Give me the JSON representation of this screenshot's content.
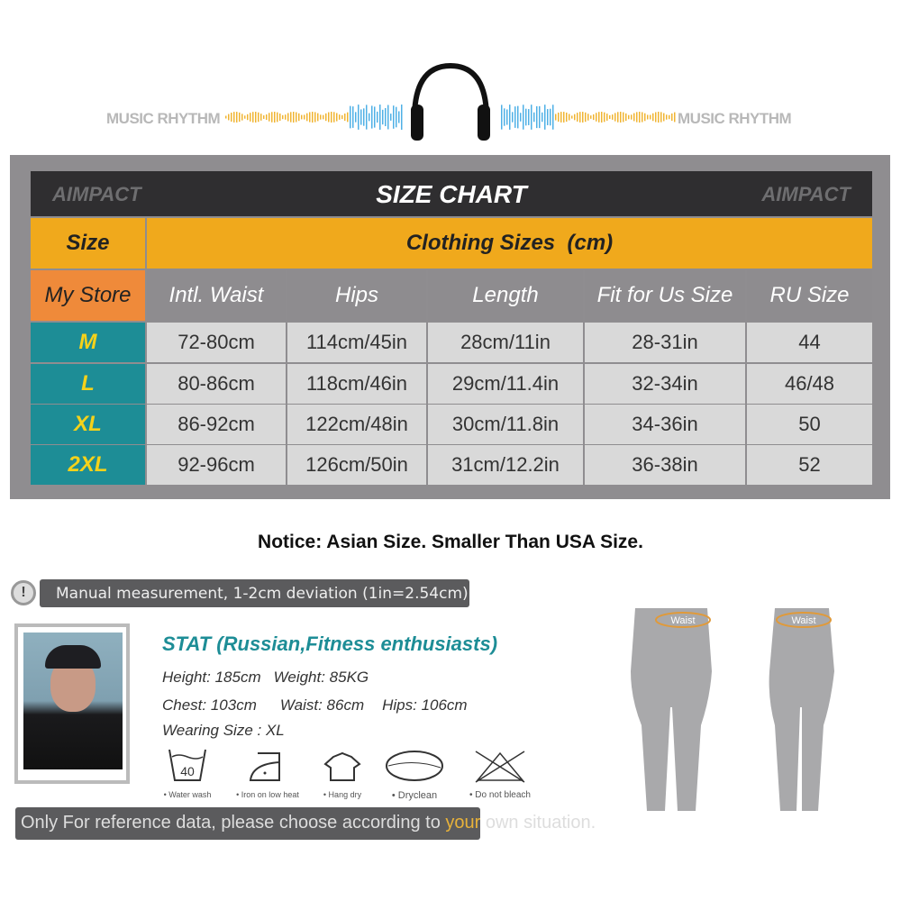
{
  "banner": {
    "left_text": "MUSIC RHYTHM",
    "right_text": "MUSIC RHYTHM",
    "icon": "headphones-icon",
    "wave_colors": {
      "outer": "#f0b432",
      "inner": "#4fb0e6"
    }
  },
  "chart": {
    "title": "SIZE CHART",
    "brand": "AIMPACT",
    "size_label": "Size",
    "group_label": "Clothing Sizes  (cm)",
    "store_label": "My Store",
    "columns": [
      "Intl. Waist",
      "Hips",
      "Length",
      "Fit for Us Size",
      "RU Size"
    ],
    "rows": [
      {
        "size": "M",
        "values": [
          "72-80cm",
          "114cm/45in",
          "28cm/11in",
          "28-31in",
          "44"
        ]
      },
      {
        "size": "L",
        "values": [
          "80-86cm",
          "118cm/46in",
          "29cm/11.4in",
          "32-34in",
          "46/48"
        ]
      },
      {
        "size": "XL",
        "values": [
          "86-92cm",
          "122cm/48in",
          "30cm/11.8in",
          "34-36in",
          "50"
        ]
      },
      {
        "size": "2XL",
        "values": [
          "92-96cm",
          "126cm/50in",
          "31cm/12.2in",
          "36-38in",
          "52"
        ]
      }
    ],
    "colors": {
      "orange": "#f0a91c",
      "teal": "#1d8d96",
      "store": "#ef8a3a",
      "header": "#8e8c8f"
    }
  },
  "notice": "Notice: Asian Size. Smaller Than USA Size.",
  "measure_note": "Manual measurement, 1-2cm deviation (1in=2.54cm)",
  "model": {
    "title": "STAT (Russian,Fitness enthusiasts)",
    "line1a": "Height: 185cm",
    "line1b": "Weight: 85KG",
    "line2a": "Chest: 103cm",
    "line2b": "Waist: 86cm",
    "line2c": "Hips: 106cm",
    "line3": "Wearing Size : XL"
  },
  "care": [
    {
      "icon": "wash-40-icon",
      "label": "• Water wash",
      "temp": "40"
    },
    {
      "icon": "iron-low-icon",
      "label": "• Iron on low heat"
    },
    {
      "icon": "hang-dry-icon",
      "label": "• Hang dry"
    },
    {
      "icon": "dryclean-icon",
      "label": "• Dryclean"
    },
    {
      "icon": "no-bleach-icon",
      "label": "• Do not bleach"
    }
  ],
  "reference": {
    "before": "Only For reference data, please choose according to ",
    "highlight": "your",
    "after": " own situation."
  },
  "figure": {
    "waist_label": "Waist"
  }
}
